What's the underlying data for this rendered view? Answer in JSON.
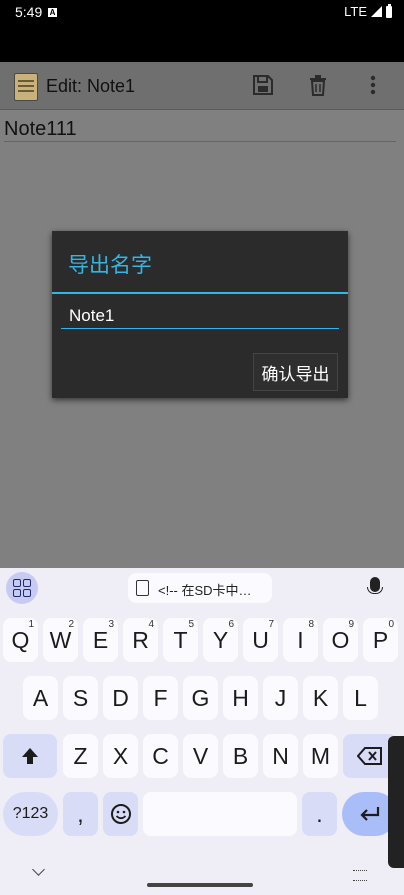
{
  "status_bar": {
    "time": "5:49",
    "notif_letter": "A",
    "network": "LTE"
  },
  "toolbar": {
    "title": "Edit: Note1"
  },
  "editor": {
    "text": "Note111"
  },
  "dialog": {
    "title": "导出名字",
    "input_value": "Note1",
    "confirm_label": "确认导出"
  },
  "keyboard": {
    "clipboard_text": "<!-- 在SD卡中…",
    "row1": [
      "Q",
      "W",
      "E",
      "R",
      "T",
      "Y",
      "U",
      "I",
      "O",
      "P"
    ],
    "row1_hints": [
      "1",
      "2",
      "3",
      "4",
      "5",
      "6",
      "7",
      "8",
      "9",
      "0"
    ],
    "row2": [
      "A",
      "S",
      "D",
      "F",
      "G",
      "H",
      "J",
      "K",
      "L"
    ],
    "row3": [
      "Z",
      "X",
      "C",
      "V",
      "B",
      "N",
      "M"
    ],
    "symbols_label": "?123",
    "comma_label": ",",
    "period_label": "."
  },
  "colors": {
    "accent": "#33b5e5",
    "keyboard_bg": "#efedf6"
  },
  "icons": [
    "save-icon",
    "delete-icon",
    "more-icon",
    "apps-icon",
    "clipboard-icon",
    "mic-icon",
    "shift-icon",
    "backspace-icon",
    "emoji-icon",
    "enter-icon"
  ]
}
